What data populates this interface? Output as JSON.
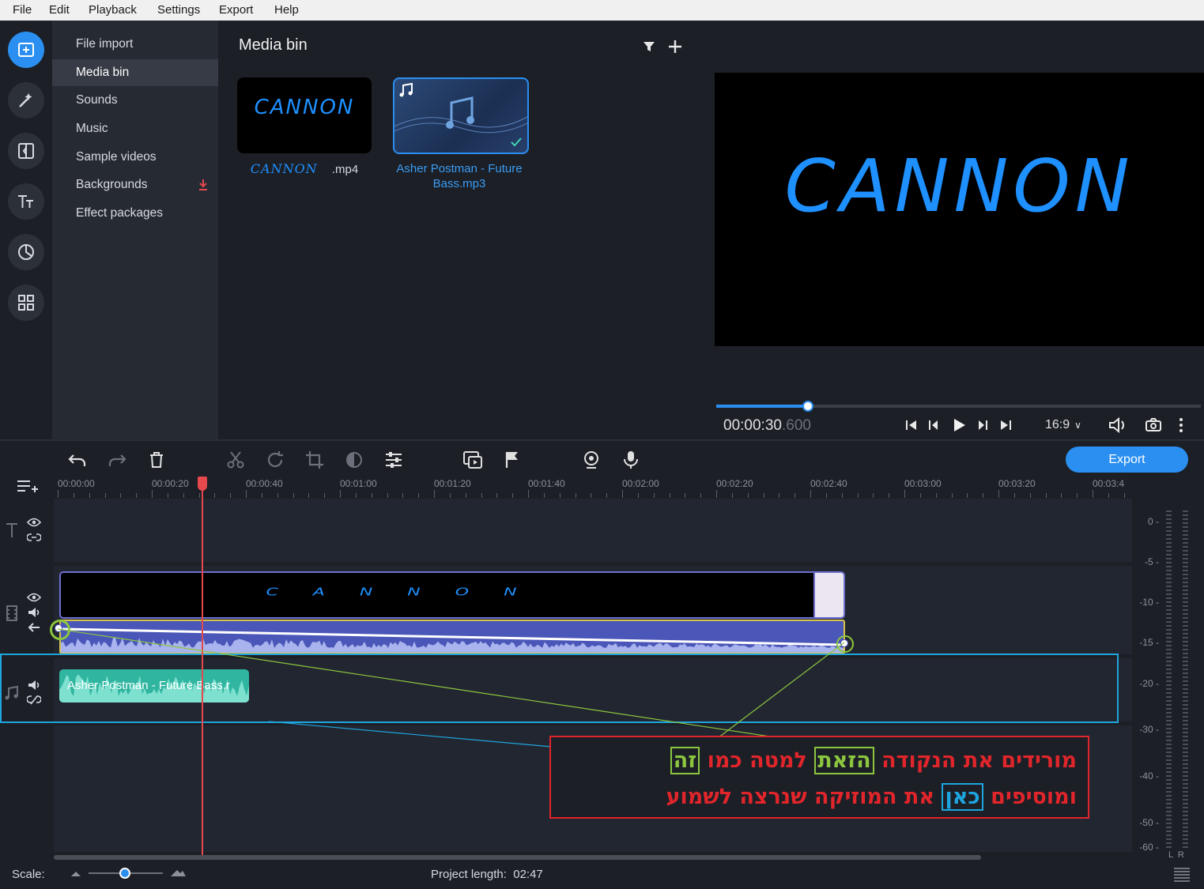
{
  "menu": [
    "File",
    "Edit",
    "Playback",
    "Settings",
    "Export",
    "Help"
  ],
  "categories": [
    {
      "label": "File import"
    },
    {
      "label": "Media bin"
    },
    {
      "label": "Sounds"
    },
    {
      "label": "Music"
    },
    {
      "label": "Sample videos"
    },
    {
      "label": "Backgrounds"
    },
    {
      "label": "Effect packages"
    }
  ],
  "bin": {
    "title": "Media bin",
    "items": [
      {
        "name_art": "CANNON",
        "ext": ".mp4",
        "thumb_art": "CANNON"
      },
      {
        "name": "Asher Postman - Future Bass.mp3"
      }
    ]
  },
  "preview": {
    "screen_text": "CANNON",
    "time_main": "00:00:30",
    "time_ms": ".600",
    "aspect": "16:9",
    "progress_fraction": 0.19
  },
  "timeline": {
    "export_label": "Export",
    "ruler": [
      "00:00:00",
      "00:00:20",
      "00:00:40",
      "00:01:00",
      "00:01:20",
      "00:01:40",
      "00:02:00",
      "00:02:20",
      "00:02:40",
      "00:03:00",
      "00:03:20",
      "00:03:4"
    ],
    "video_clip_text": "CANNON",
    "music_clip_label": "Asher Postman - Future Bass.r",
    "meter": [
      "0 -",
      "-5 -",
      "-10 -",
      "-15 -",
      "-20 -",
      "-30 -",
      "-40 -",
      "-50 -",
      "-60 -"
    ],
    "meter_lr": "L  R",
    "scale_label": "Scale:",
    "project_length": "Project length:  02:47"
  },
  "annotation": {
    "line1": [
      "מורידים את הנקודה ",
      "הזאת",
      " למטה כמו ",
      "זה"
    ],
    "line2": [
      "ומוסיפים ",
      "כאן",
      " את המוזיקה שנרצה לשמוע"
    ]
  },
  "colors": {
    "accent": "#2a8ff0",
    "annotation_red": "#e0252b",
    "annotation_green": "#8cc63f",
    "annotation_blue": "#1ea6e0",
    "music_clip": "#2fb5a0",
    "audio_track": "#4a57b8"
  }
}
